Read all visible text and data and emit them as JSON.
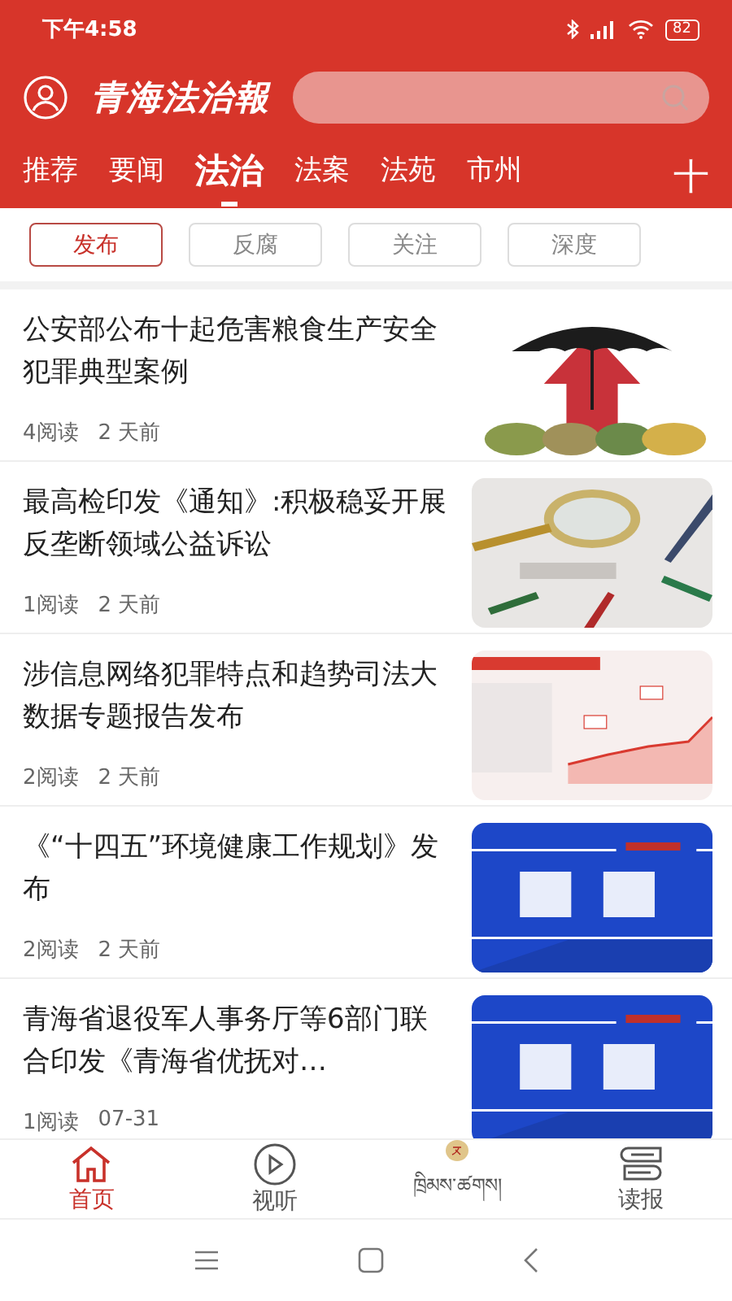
{
  "status_bar": {
    "time": "下午4:58",
    "battery": "82"
  },
  "header": {
    "logo": "青海法治報"
  },
  "channels": [
    {
      "label": "推荐",
      "selected": false
    },
    {
      "label": "要闻",
      "selected": false
    },
    {
      "label": "法治",
      "selected": true
    },
    {
      "label": "法案",
      "selected": false
    },
    {
      "label": "法苑",
      "selected": false
    },
    {
      "label": "市州",
      "selected": false
    }
  ],
  "add_channel": "十",
  "filters": [
    {
      "label": "发布",
      "selected": true
    },
    {
      "label": "反腐",
      "selected": false
    },
    {
      "label": "关注",
      "selected": false
    },
    {
      "label": "深度",
      "selected": false
    }
  ],
  "articles": [
    {
      "title": "公安部公布十起危害粮食生产安全犯罪典型案例",
      "reads": "4阅读",
      "time": "2 天前",
      "kind": "picture"
    },
    {
      "title": "最高检印发《通知》:积极稳妥开展反垄断领域公益诉讼",
      "reads": "1阅读",
      "time": "2 天前",
      "kind": "picture"
    },
    {
      "title": "涉信息网络犯罪特点和趋势司法大数据专题报告发布",
      "reads": "2阅读",
      "time": "2 天前",
      "kind": "picture"
    },
    {
      "title": "《“十四五”环境健康工作规划》发布",
      "reads": "2阅读",
      "time": "2 天前",
      "kind": "picture"
    },
    {
      "title": "青海省退役军人事务厅等6部门联合印发《青海省优抚对…",
      "reads": "1阅读",
      "time": "07-31",
      "kind": "picture"
    }
  ],
  "tabbar": [
    {
      "label": "首页",
      "selected": true
    },
    {
      "label": "视听",
      "selected": false
    },
    {
      "label": "ཁྲིམས་ཚགས།",
      "selected": false
    },
    {
      "label": "读报",
      "selected": false
    }
  ]
}
